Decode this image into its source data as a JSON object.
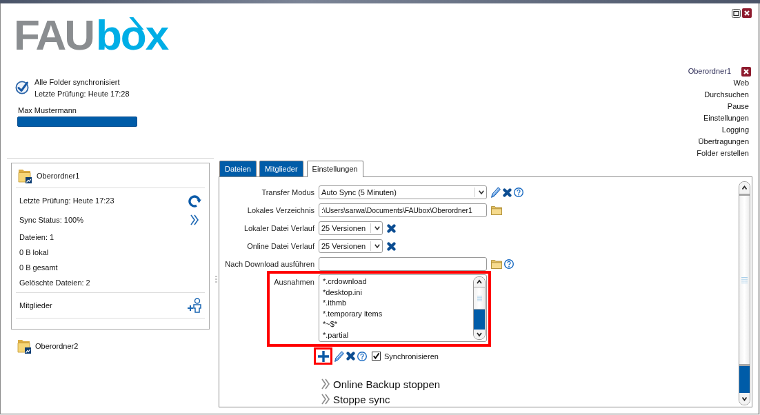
{
  "logo": {
    "part_1": "FAU",
    "part_2": "box"
  },
  "sync_status": {
    "message": "Alle Folder synchronisiert",
    "last_check": "Letzte Prüfung: Heute 17:28"
  },
  "user": {
    "name": "Max Mustermann"
  },
  "header_menu": {
    "current_folder": "Oberordner1",
    "links": [
      "Web",
      "Durchsuchen",
      "Pause",
      "Einstellungen",
      "Logging",
      "Übertragungen",
      "Folder erstellen"
    ]
  },
  "folders": [
    {
      "name": "Oberordner1",
      "expanded": true,
      "details": [
        {
          "kind": "refresh",
          "text": "Letzte Prüfung: Heute 17:23"
        },
        {
          "kind": "open",
          "text": "Sync Status: 100%"
        },
        {
          "kind": "plain",
          "text": "Dateien: 1"
        },
        {
          "kind": "plain",
          "text": "0 B lokal"
        },
        {
          "kind": "plain",
          "text": "0 B gesamt"
        },
        {
          "kind": "plain",
          "text": "Gelöschte Dateien: 2"
        }
      ],
      "members": {
        "label": "Mitglieder"
      }
    },
    {
      "name": "Oberordner2",
      "expanded": false
    }
  ],
  "tabs": [
    {
      "label": "Dateien",
      "selected": false
    },
    {
      "label": "Mitglieder",
      "selected": false
    },
    {
      "label": "Einstellungen",
      "selected": true
    }
  ],
  "settings": {
    "fields": [
      {
        "label": "Transfer Modus",
        "kind": "select",
        "value": "Auto Sync (5 Minuten)",
        "actions": [
          {
            "kind": "edit"
          },
          {
            "kind": "remove"
          },
          {
            "kind": "help"
          }
        ]
      },
      {
        "label": "Lokales Verzeichnis",
        "kind": "text",
        "value": ":\\Users\\sarwa\\Documents\\FAUbox\\Oberordner1",
        "actions": [
          {
            "kind": "browse"
          }
        ]
      },
      {
        "label": "Lokaler Datei Verlauf",
        "kind": "shortselect",
        "value": "25 Versionen",
        "actions": [
          {
            "kind": "remove"
          }
        ]
      },
      {
        "label": "Online Datei Verlauf",
        "kind": "shortselect",
        "value": "25 Versionen",
        "actions": [
          {
            "kind": "remove"
          }
        ]
      },
      {
        "label": "Nach Download ausführen",
        "kind": "text",
        "actions": [
          {
            "kind": "browse"
          },
          {
            "kind": "help"
          }
        ]
      }
    ],
    "exclusions": {
      "label": "Ausnahmen",
      "highlighted": true,
      "items": [
        "*.crdownload",
        "*desktop.ini",
        "*.ithmb",
        "*.temporary items",
        "*~$*",
        "*.partial"
      ],
      "actions": [
        {
          "kind": "add",
          "highlighted": true
        },
        {
          "kind": "edit",
          "highlighted": false
        },
        {
          "kind": "remove",
          "highlighted": false
        },
        {
          "kind": "help",
          "highlighted": false
        }
      ],
      "sync": {
        "label": "Synchronisieren",
        "checked": true
      }
    },
    "commands": [
      "Online Backup stoppen",
      "Stoppe sync"
    ]
  }
}
